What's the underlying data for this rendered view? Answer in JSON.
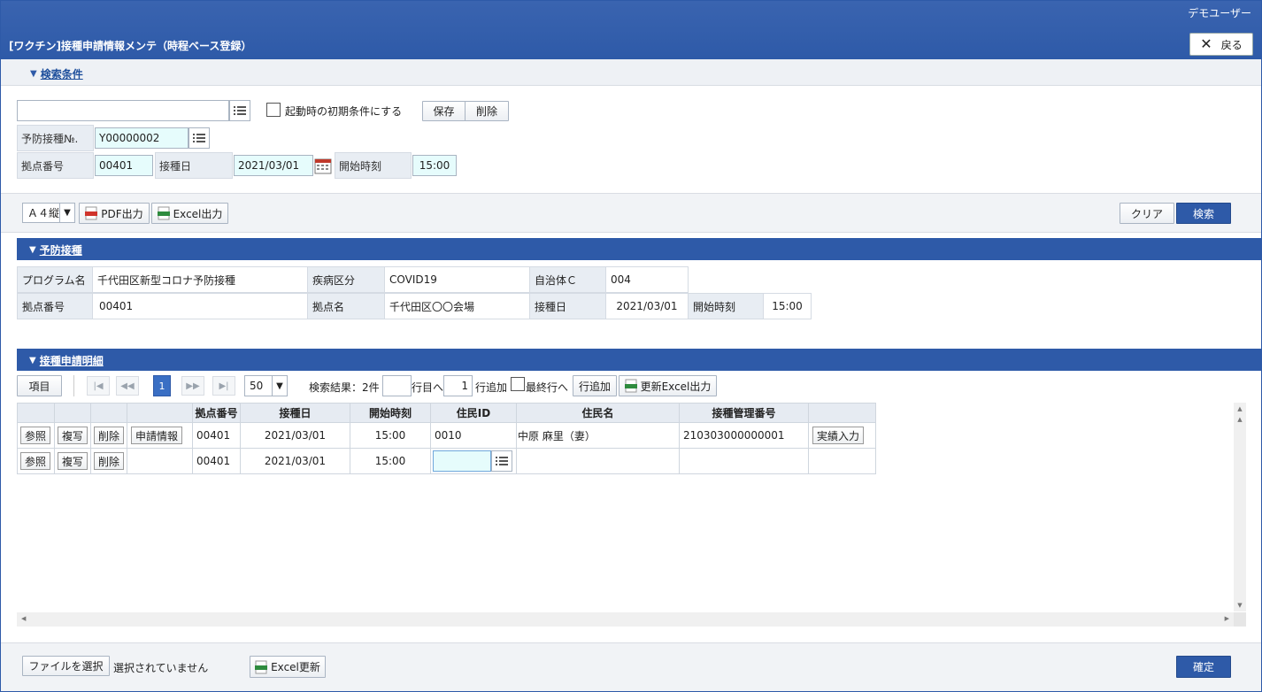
{
  "header": {
    "user": "デモユーザー",
    "title": "[ワクチン]接種申請情報メンテ（時程ベース登録）",
    "back_label": "戻る"
  },
  "search_conditions": {
    "section_title": "検索条件",
    "saved_condition_value": "",
    "startup_checkbox_label": "起動時の初期条件にする",
    "save_label": "保存",
    "delete_label": "削除",
    "vaccination_no_label": "予防接種№.",
    "vaccination_no_value": "Y00000002",
    "site_no_label": "拠点番号",
    "site_no_value": "00401",
    "date_label": "接種日",
    "date_value": "2021/03/01",
    "start_time_label": "開始時刻",
    "start_time_value": "15:00"
  },
  "toolbar": {
    "paper_size": "Ａ４縦",
    "pdf_label": "PDF出力",
    "excel_label": "Excel出力",
    "clear_label": "クリア",
    "search_label": "検索"
  },
  "vaccination": {
    "section_title": "予防接種",
    "program_label": "プログラム名",
    "program_value": "千代田区新型コロナ予防接種",
    "disease_label": "疾病区分",
    "disease_value": "COVID19",
    "municipality_label": "自治体Ｃ",
    "municipality_value": "004",
    "site_no_label": "拠点番号",
    "site_no_value": "00401",
    "site_name_label": "拠点名",
    "site_name_value": "千代田区〇〇会場",
    "date_label": "接種日",
    "date_value": "2021/03/01",
    "start_time_label": "開始時刻",
    "start_time_value": "15:00"
  },
  "details": {
    "section_title": "接種申請明細",
    "items_label": "項目",
    "current_page": "1",
    "page_size": "50",
    "result_count": "検索結果：2件",
    "goto_row_value": "",
    "goto_row_suffix": "行目へ",
    "add_rows_value": "1",
    "add_rows_suffix": "行追加",
    "last_row_label": "最終行へ",
    "add_row_button": "行追加",
    "update_excel_button": "更新Excel出力",
    "columns": [
      "",
      "",
      "",
      "",
      "拠点番号",
      "接種日",
      "開始時刻",
      "住民ID",
      "住民名",
      "接種管理番号",
      ""
    ],
    "row_buttons": {
      "view": "参照",
      "copy": "複写",
      "delete": "削除",
      "application": "申請情報",
      "result_entry": "実績入力"
    },
    "rows": [
      {
        "site_no": "00401",
        "date": "2021/03/01",
        "time": "15:00",
        "resident_id": "0010",
        "resident_name": "中原 麻里（妻）",
        "mgmt_no": "210303000000001"
      },
      {
        "site_no": "00401",
        "date": "2021/03/01",
        "time": "15:00",
        "resident_id": "",
        "resident_name": "",
        "mgmt_no": ""
      }
    ]
  },
  "footer": {
    "choose_file_label": "ファイルを選択",
    "no_file_text": "選択されていません",
    "excel_update_label": "Excel更新",
    "confirm_label": "確定"
  }
}
